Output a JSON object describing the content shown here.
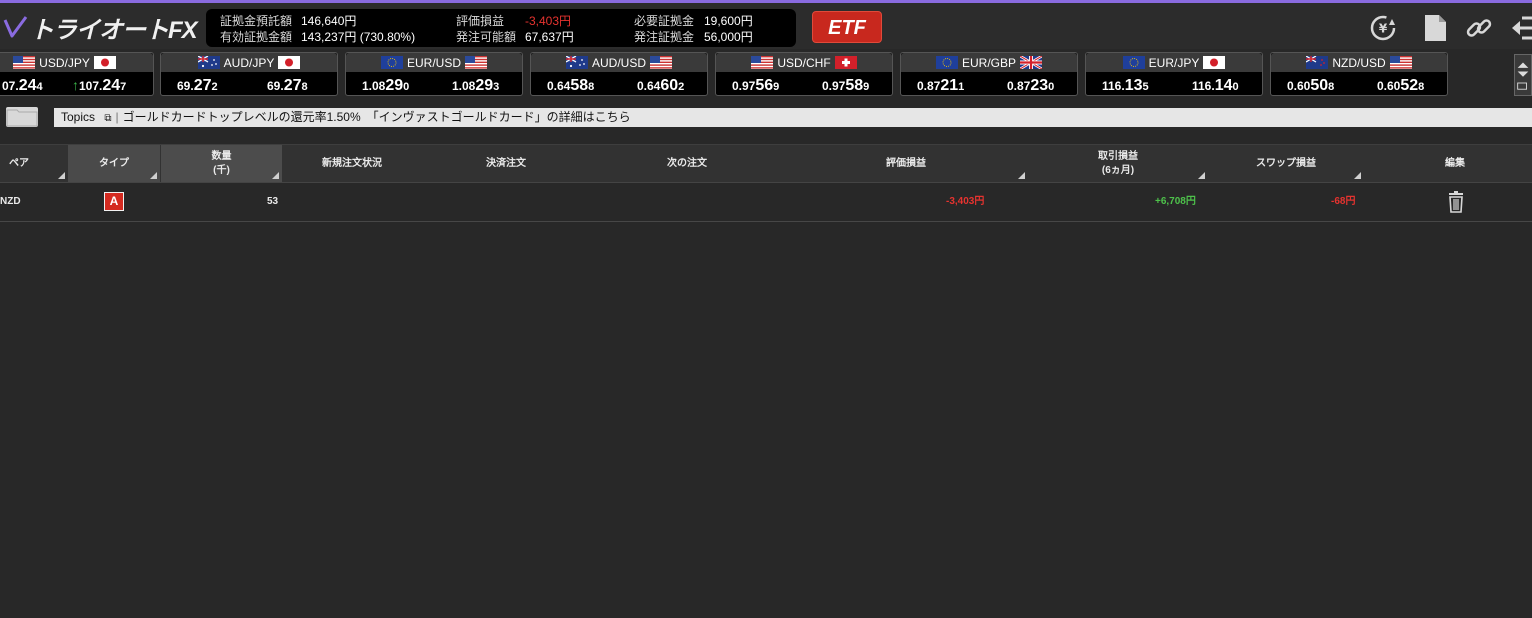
{
  "app": {
    "name": "トライオートFX"
  },
  "account": {
    "deposit_label": "証拠金預託額",
    "deposit_value": "146,640円",
    "effective_label": "有効証拠金額",
    "effective_value": "143,237円 (730.80%)",
    "unrealized_label": "評価損益",
    "unrealized_value": "-3,403円",
    "orderable_label": "発注可能額",
    "orderable_value": "67,637円",
    "required_label": "必要証拠金",
    "required_value": "19,600円",
    "order_margin_label": "発注証拠金",
    "order_margin_value": "56,000円"
  },
  "etf_button": "ETF",
  "rates": [
    {
      "pair": "USD/JPY",
      "bid_a": "07.",
      "bid_b": "24",
      "bid_c": "4",
      "ask_a": "107.",
      "ask_b": "24",
      "ask_c": "7",
      "flag1": "us",
      "flag2": "jp",
      "arrow": "↑"
    },
    {
      "pair": "AUD/JPY",
      "bid_a": "69.",
      "bid_b": "27",
      "bid_c": "2",
      "ask_a": "69.",
      "ask_b": "27",
      "ask_c": "8",
      "flag1": "au",
      "flag2": "jp"
    },
    {
      "pair": "EUR/USD",
      "bid_a": "1.08",
      "bid_b": "29",
      "bid_c": "0",
      "ask_a": "1.08",
      "ask_b": "29",
      "ask_c": "3",
      "flag1": "eu",
      "flag2": "us"
    },
    {
      "pair": "AUD/USD",
      "bid_a": "0.64",
      "bid_b": "58",
      "bid_c": "8",
      "ask_a": "0.64",
      "ask_b": "60",
      "ask_c": "2",
      "flag1": "au",
      "flag2": "us"
    },
    {
      "pair": "USD/CHF",
      "bid_a": "0.97",
      "bid_b": "56",
      "bid_c": "9",
      "ask_a": "0.97",
      "ask_b": "58",
      "ask_c": "9",
      "flag1": "us",
      "flag2": "ch"
    },
    {
      "pair": "EUR/GBP",
      "bid_a": "0.87",
      "bid_b": "21",
      "bid_c": "1",
      "ask_a": "0.87",
      "ask_b": "23",
      "ask_c": "0",
      "flag1": "eu",
      "flag2": "gb"
    },
    {
      "pair": "EUR/JPY",
      "bid_a": "116.",
      "bid_b": "13",
      "bid_c": "5",
      "ask_a": "116.",
      "ask_b": "14",
      "ask_c": "0",
      "flag1": "eu",
      "flag2": "jp"
    },
    {
      "pair": "NZD/USD",
      "bid_a": "0.60",
      "bid_b": "50",
      "bid_c": "8",
      "ask_a": "0.60",
      "ask_b": "52",
      "ask_c": "8",
      "flag1": "nz",
      "flag2": "us"
    }
  ],
  "topics": {
    "label": "Topics",
    "text": "ゴールドカードトップレベルの還元率1.50%　「インヴァストゴールドカード」の詳細はこちら"
  },
  "table": {
    "headers": {
      "pair": "ペア",
      "type": "タイプ",
      "qty_1": "数量",
      "qty_2": "(千)",
      "new_order": "新規注文状況",
      "settle": "決済注文",
      "next": "次の注文",
      "unrealized": "評価損益",
      "trade_pl_1": "取引損益",
      "trade_pl_2": "(6ヵ月)",
      "swap": "スワップ損益",
      "edit": "編集"
    },
    "row": {
      "pair": "NZD",
      "type": "A",
      "qty": "53",
      "unrealized": "-3,403円",
      "trade_pl": "+6,708円",
      "swap": "-68円"
    }
  },
  "colors": {
    "accent": "#8a6be0",
    "negative": "#e6332f",
    "positive": "#4ec24b",
    "etf": "#c8281e"
  }
}
